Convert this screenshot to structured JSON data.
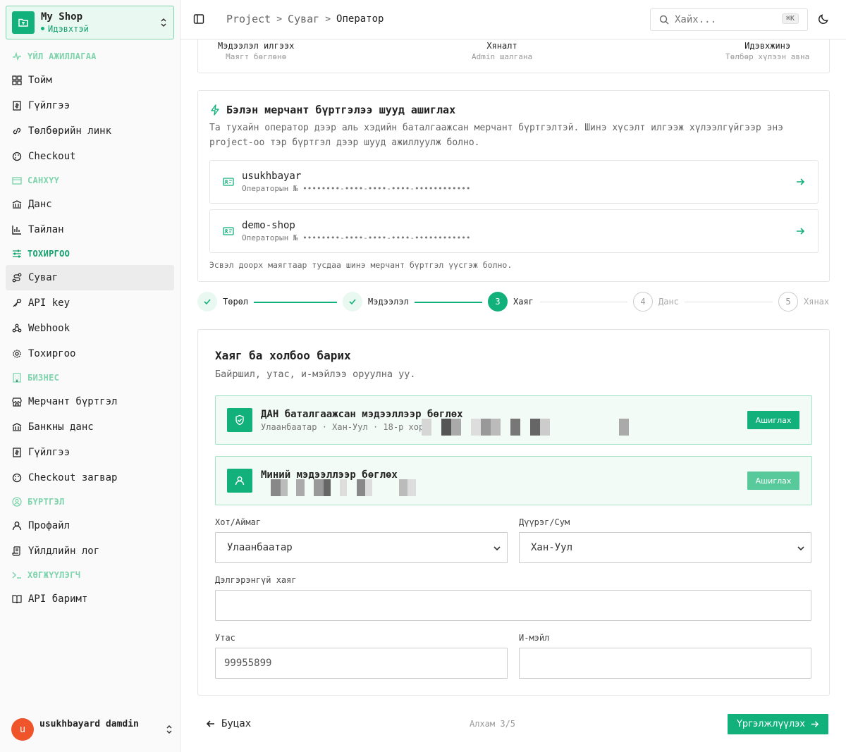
{
  "shop": {
    "name": "My Shop",
    "status": "Идэвхтэй"
  },
  "nav": {
    "sections": {
      "operations": "ҮЙЛ АЖИЛЛАГАА",
      "finance": "САНХҮҮ",
      "settings": "ТОХИРГОО",
      "business": "БИЗНЕС",
      "account": "БҮРТГЭЛ",
      "developer": "ХӨГЖҮҮЛЭГЧ"
    },
    "items": {
      "overview": "Тойм",
      "transactions": "Гүйлгээ",
      "payment_link": "Төлбөрийн линк",
      "checkout": "Checkout",
      "accounts": "Данс",
      "reports": "Тайлан",
      "channel": "Суваг",
      "api_key": "API key",
      "webhook": "Webhook",
      "settings": "Тохиргоо",
      "merchant_reg": "Мерчант бүртгэл",
      "bank_account": "Банкны данс",
      "biz_transactions": "Гүйлгээ",
      "checkout_template": "Checkout загвар",
      "profile": "Профайл",
      "activity_log": "Үйлдлийн лог",
      "api_docs": "API баримт"
    }
  },
  "user": {
    "initial": "u",
    "name": "usukhbayard damdin"
  },
  "topbar": {
    "crumbs": [
      "Project",
      "Суваг",
      "Оператор"
    ],
    "search_placeholder": "Хайх...",
    "shortcut": "⌘K"
  },
  "info_row": [
    {
      "title": "Мэдээлэл илгээх",
      "sub": "Маягт бөглөнө"
    },
    {
      "title": "Хяналт",
      "sub": "Admin шалгана"
    },
    {
      "title": "Идэвхжинэ",
      "sub": "Төлбөр хүлээн авна"
    }
  ],
  "merchant_card": {
    "title": "Бэлэн мерчант бүртгэлээ шууд ашиглах",
    "desc": "Та тухайн оператор дээр аль хэдийн баталгаажсан мерчант бүртгэлтэй. Шинэ хүсэлт илгээж хүлээлгүйгээр энэ project-оо тэр бүртгэл дээр шууд ажиллуулж болно.",
    "merchants": [
      {
        "name": "usukhbayar",
        "op": "Операторын № ••••••••-••••-••••-••••-••••••••••••"
      },
      {
        "name": "demo-shop",
        "op": "Операторын № ••••••••-••••-••••-••••-••••••••••••"
      }
    ],
    "footer": "Эсвэл доорх маягтаар тусдаа шинэ мерчант бүртгэл үүсгэж болно."
  },
  "stepper": {
    "steps": [
      {
        "num": "1",
        "label": "Төрөл",
        "state": "done"
      },
      {
        "num": "2",
        "label": "Мэдээлэл",
        "state": "done"
      },
      {
        "num": "3",
        "label": "Хаяг",
        "state": "current"
      },
      {
        "num": "4",
        "label": "Данс",
        "state": "todo"
      },
      {
        "num": "5",
        "label": "Хянах",
        "state": "todo"
      }
    ]
  },
  "address": {
    "title": "Хаяг ба холбоо барих",
    "subtitle": "Байршил, утас, и-мэйлээ оруулна уу.",
    "option_dan": {
      "title": "ДАН баталгаажсан мэдээллээр бөглөх",
      "sub": "Улаанбаатар · Хан-Уул · 18-р хор",
      "button": "Ашиглах"
    },
    "option_mine": {
      "title": "Миний мэдээллээр бөглөх",
      "button": "Ашиглах"
    },
    "city_label": "Хот/Аймаг",
    "city_value": "Улаанбаатар",
    "district_label": "Дүүрэг/Сум",
    "district_value": "Хан-Уул",
    "detail_label": "Дэлгэрэнгүй хаяг",
    "detail_value": "",
    "phone_label": "Утас",
    "phone_value": "99955899",
    "email_label": "И-мэйл",
    "email_value": ""
  },
  "footer": {
    "back": "Буцах",
    "step_count": "Алхам 3/5",
    "next": "Үргэлжлүүлэх"
  },
  "colors": {
    "accent": "#12b07a",
    "accent_light": "#e9f8f0",
    "danger_avatar": "#f0542a"
  }
}
